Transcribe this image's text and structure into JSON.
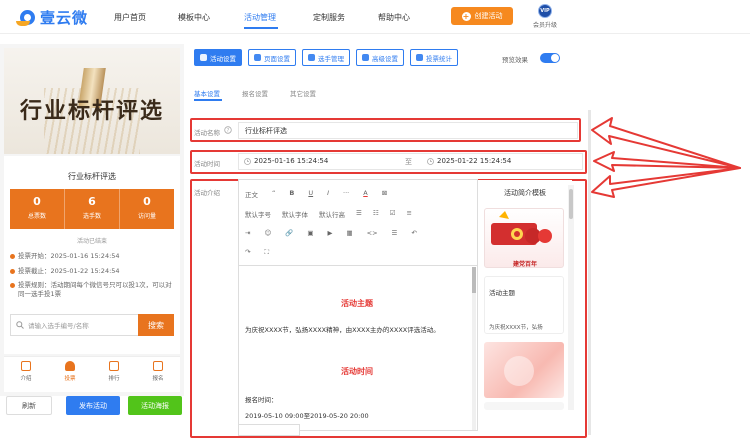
{
  "brand": {
    "name": "壹云微"
  },
  "nav": {
    "items": [
      "用户首页",
      "模板中心",
      "活动管理",
      "定制服务",
      "帮助中心"
    ],
    "create_label": "创建活动",
    "vip_badge": "VIP",
    "vip_label": "会员升级"
  },
  "preview": {
    "banner_title": "行业标杆评选",
    "card_title": "行业标杆评选",
    "stats": [
      {
        "value": "0",
        "label": "总票数"
      },
      {
        "value": "6",
        "label": "选手数"
      },
      {
        "value": "0",
        "label": "访问量"
      }
    ],
    "status": "活动已结束",
    "info": [
      "投票开始：2025-01-16 15:24:54",
      "投票截止：2025-01-22 15:24:54",
      "投票规则：活动期间每个微信号只可以投1次，可以对同一选手投1票"
    ],
    "search_placeholder": "请输入选手编号/名称",
    "search_button": "搜索",
    "tabs": [
      "介绍",
      "投票",
      "排行",
      "报名"
    ]
  },
  "bottom_buttons": {
    "refresh": "刷新",
    "publish": "发布活动",
    "poster": "活动海报"
  },
  "toolbar": {
    "buttons": [
      "活动设置",
      "页面设置",
      "选手管理",
      "高级设置",
      "投票统计"
    ],
    "preview_label": "预览效果",
    "preview_enabled": true
  },
  "subtabs": [
    "基本设置",
    "报名设置",
    "其它设置"
  ],
  "form": {
    "name_label": "活动名称",
    "name_value": "行业标杆评选",
    "time_label": "活动时间",
    "time_start": "2025-01-16 15:24:54",
    "time_sep": "至",
    "time_end": "2025-01-22 15:24:54",
    "intro_label": "活动介绍"
  },
  "editor": {
    "toolbar_row1": [
      "正文",
      "“",
      "B",
      "U",
      "I",
      "···",
      "A",
      "⊠"
    ],
    "toolbar_row2": [
      "默认字号",
      "默认字体",
      "默认行高",
      "☰",
      "☷",
      "☑",
      "≡"
    ],
    "toolbar_row3": [
      "⇥",
      "☺",
      "🔗",
      "▣",
      "▶",
      "▦",
      "<>",
      "☰",
      "↶"
    ],
    "toolbar_row4": [
      "↷",
      "⛶"
    ],
    "heading1": "活动主题",
    "para1": "为庆祝XXXX节，弘扬XXXX精神，由XXXX主办的XXXX评选活动。",
    "heading2": "活动时间",
    "line_reg": "报名时间：",
    "line_dates": "2019-05-10 09:00至2019-05-20 20:00"
  },
  "templates": {
    "title": "活动简介模板",
    "card1_caption": "建党百年",
    "card2_title": "活动主题",
    "card2_text": "为庆祝XXXX节，弘扬"
  },
  "colors": {
    "primary": "#2f7cf0",
    "orange": "#e8741e",
    "annotation_red": "#e53935",
    "green": "#52c41a"
  }
}
